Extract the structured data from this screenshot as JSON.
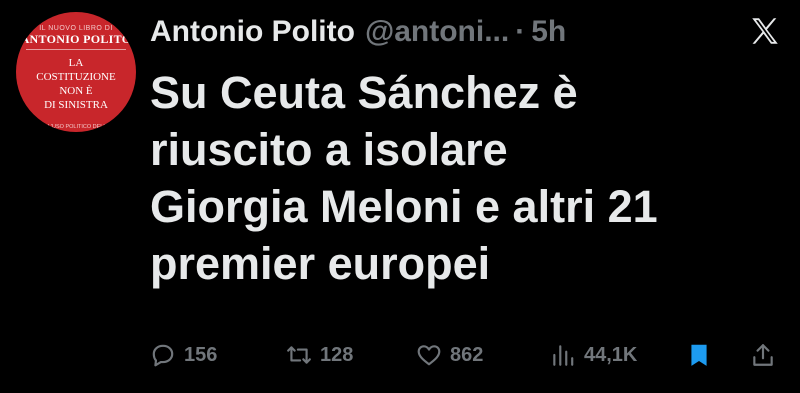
{
  "colors": {
    "background": "#000000",
    "text": "#e7e9ea",
    "muted": "#71767b",
    "bookmark": "#1d9bf0",
    "avatar_red": "#c8262b"
  },
  "avatar": {
    "top_text": "IL NUOVO LIBRO DI",
    "author": "ANTONIO POLITO",
    "title_lines": [
      "LA",
      "COSTITUZIONE",
      "NON È",
      "DI SINISTRA"
    ],
    "subtitle": "CONTRO L'USO POLITICO DELLA CARTA"
  },
  "header": {
    "name": "Antonio Polito",
    "handle": "@antoni...",
    "separator": "·",
    "time": "5h",
    "logo_icon": "x-logo-icon"
  },
  "tweet": {
    "lines": [
      "Su Ceuta Sánchez è",
      "riuscito a isolare",
      "Giorgia Meloni e altri 21",
      "premier europei"
    ]
  },
  "actions": {
    "replies": "156",
    "retweets": "128",
    "likes": "862",
    "views": "44,1K",
    "icons": [
      "reply-icon",
      "retweet-icon",
      "like-icon",
      "views-icon",
      "bookmark-icon",
      "share-icon"
    ]
  }
}
